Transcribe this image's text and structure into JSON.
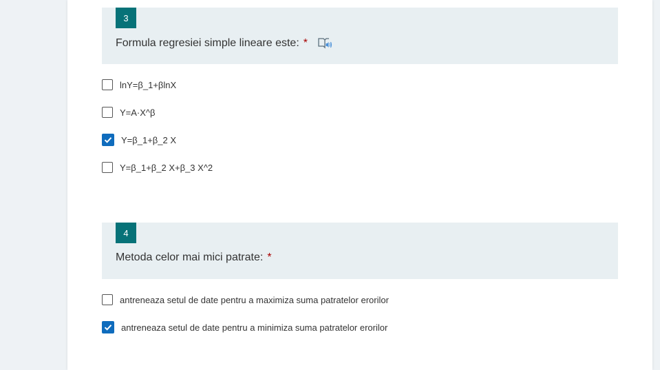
{
  "questions": [
    {
      "number": "3",
      "title": "Formula regresiei simple lineare este:",
      "required_mark": "*",
      "icon": "immersive-reader-icon",
      "options": [
        {
          "label": "lnY=β_1+βlnX",
          "checked": false
        },
        {
          "label": "Y=A·X^β",
          "checked": false
        },
        {
          "label": "Y=β_1+β_2 X",
          "checked": true
        },
        {
          "label": "Y=β_1+β_2 X+β_3 X^2",
          "checked": false
        }
      ]
    },
    {
      "number": "4",
      "title": "Metoda celor mai mici patrate:",
      "required_mark": "*",
      "options": [
        {
          "label": "antreneaza setul de date pentru a maximiza suma patratelor erorilor",
          "checked": false
        },
        {
          "label": "antreneaza setul de date pentru a minimiza suma patratelor erorilor",
          "checked": true
        }
      ]
    }
  ],
  "colors": {
    "accent": "#077278",
    "checkbox_checked": "#0f6cbd",
    "required": "#a80000",
    "header_bg": "#e8eff2",
    "page_bg": "#eef2f5"
  }
}
